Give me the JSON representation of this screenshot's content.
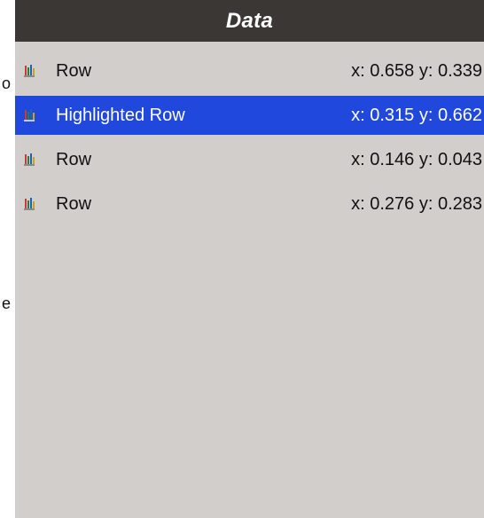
{
  "left_edge": {
    "top_fragment": "o",
    "bottom_fragment": "e"
  },
  "panel": {
    "title": "Data",
    "rows": [
      {
        "label": "Row",
        "coords": "x: 0.658 y: 0.339",
        "highlighted": false,
        "icon": "colored-markers-icon"
      },
      {
        "label": "Highlighted Row",
        "coords": "x: 0.315 y: 0.662",
        "highlighted": true,
        "icon": "colored-markers-icon"
      },
      {
        "label": "Row",
        "coords": "x: 0.146 y: 0.043",
        "highlighted": false,
        "icon": "colored-markers-icon"
      },
      {
        "label": "Row",
        "coords": "x: 0.276 y: 0.283",
        "highlighted": false,
        "icon": "colored-markers-icon"
      }
    ]
  },
  "colors": {
    "header_bg": "#3b3735",
    "panel_bg": "#d2cecc",
    "highlight_bg": "#2148dc"
  }
}
